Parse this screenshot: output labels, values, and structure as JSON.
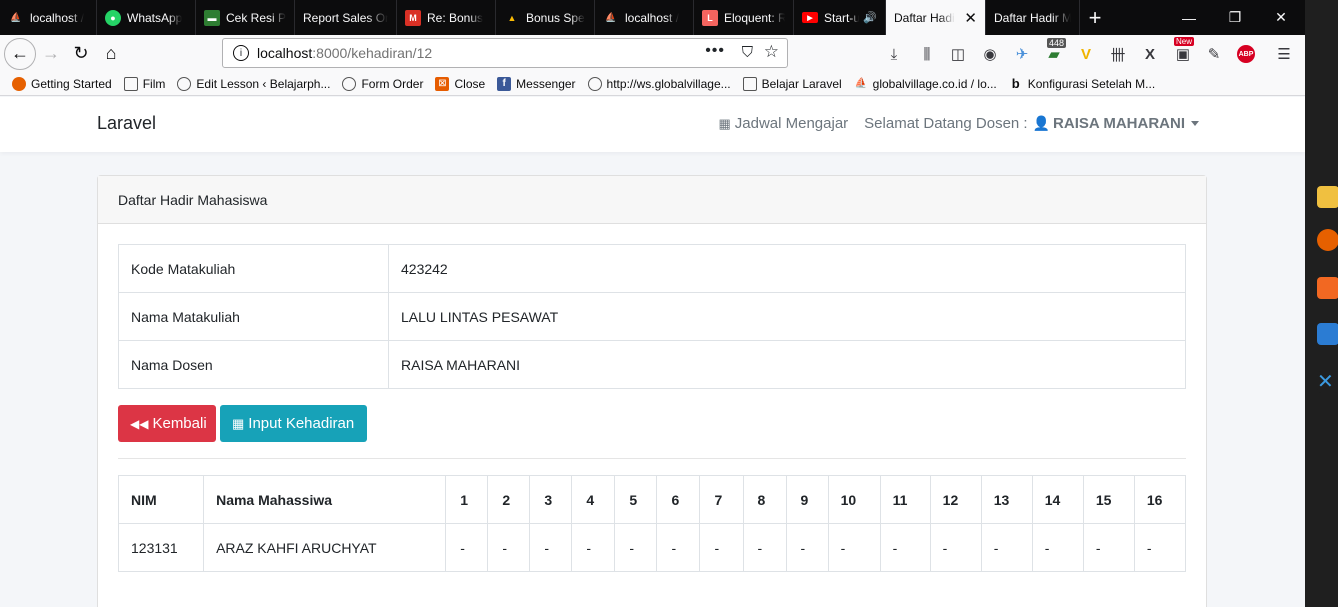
{
  "browser": {
    "tabs": [
      {
        "label": "localhost /",
        "icon": "phpmyadmin-icon",
        "color": "#f7a11a",
        "active": false
      },
      {
        "label": "WhatsApp",
        "icon": "whatsapp-icon",
        "color": "#25d366",
        "active": false
      },
      {
        "label": "Cek Resi P",
        "icon": "tracking-icon",
        "color": "#2e7d32",
        "active": false
      },
      {
        "label": "Report Sales Or",
        "icon": "",
        "color": "",
        "active": false
      },
      {
        "label": "Re: Bonus",
        "icon": "gmail-icon",
        "color": "#d93025",
        "active": false
      },
      {
        "label": "Bonus Spe",
        "icon": "google-drive-icon",
        "color": "#fbbc04",
        "active": false
      },
      {
        "label": "localhost /",
        "icon": "phpmyadmin-icon",
        "color": "#f7a11a",
        "active": false
      },
      {
        "label": "Eloquent: R",
        "icon": "laravel-icon",
        "color": "#f4645f",
        "active": false
      },
      {
        "label": "Start-up",
        "icon": "youtube-icon",
        "color": "#ff0000",
        "active": false
      },
      {
        "label": "Daftar Hadi",
        "icon": "",
        "color": "",
        "active": true
      },
      {
        "label": "Daftar Hadir M",
        "icon": "",
        "color": "",
        "active": false
      }
    ],
    "url_host": "localhost",
    "url_path": ":8000/kehadiran/12",
    "toolbar_badges": {
      "count": "448",
      "new": "New",
      "abp": "ABP"
    },
    "bookmarks": [
      {
        "label": "Getting Started",
        "icon": "firefox-icon"
      },
      {
        "label": "Film",
        "icon": "folder-icon"
      },
      {
        "label": "Edit Lesson ‹ Belajarph...",
        "icon": "globe-icon"
      },
      {
        "label": "Form Order",
        "icon": "globe-icon"
      },
      {
        "label": "Close",
        "icon": "close-app-icon"
      },
      {
        "label": "Messenger",
        "icon": "facebook-icon"
      },
      {
        "label": "http://ws.globalvillage...",
        "icon": "globe-icon"
      },
      {
        "label": "Belajar Laravel",
        "icon": "folder-icon"
      },
      {
        "label": "globalvillage.co.id / lo...",
        "icon": "phpmyadmin-icon"
      },
      {
        "label": "Konfigurasi Setelah M...",
        "icon": "bitnami-icon"
      }
    ]
  },
  "app": {
    "brand": "Laravel",
    "nav_schedule": "Jadwal Mengajar",
    "nav_greeting": "Selamat Datang Dosen :",
    "nav_user": "RAISA MAHARANI"
  },
  "card": {
    "title": "Daftar Hadir Mahasiswa",
    "info": [
      {
        "label": "Kode Matakuliah",
        "value": "423242"
      },
      {
        "label": "Nama Matakuliah",
        "value": "LALU LINTAS PESAWAT"
      },
      {
        "label": "Nama Dosen",
        "value": "RAISA MAHARANI"
      }
    ],
    "back_label": "Kembali",
    "input_label": "Input Kehadiran",
    "table": {
      "headers": [
        "NIM",
        "Nama Mahassiwa",
        "1",
        "2",
        "3",
        "4",
        "5",
        "6",
        "7",
        "8",
        "9",
        "10",
        "11",
        "12",
        "13",
        "14",
        "15",
        "16"
      ],
      "rows": [
        [
          "123131",
          "ARAZ KAHFI ARUCHYAT",
          "-",
          "-",
          "-",
          "-",
          "-",
          "-",
          "-",
          "-",
          "-",
          "-",
          "-",
          "-",
          "-",
          "-",
          "-",
          "-"
        ]
      ]
    }
  }
}
